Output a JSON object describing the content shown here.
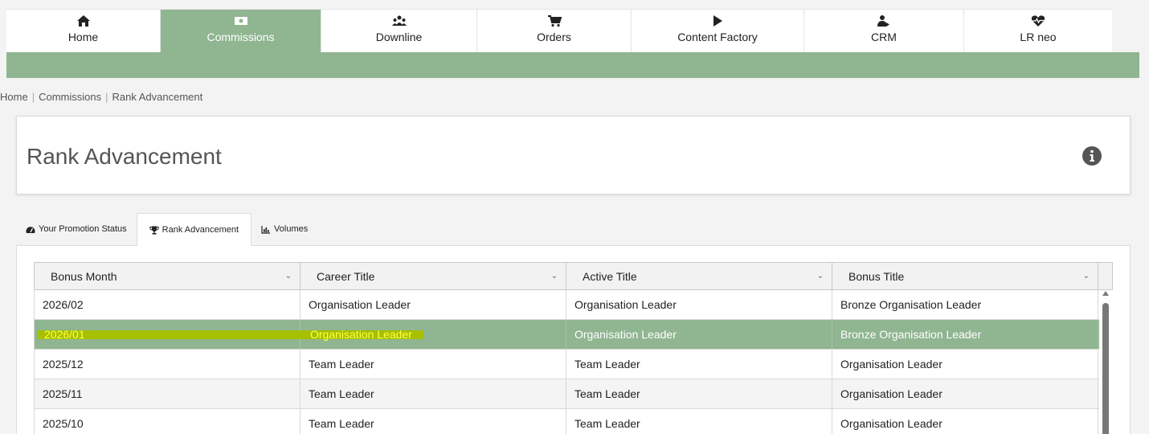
{
  "nav": {
    "items": [
      {
        "label": "Home",
        "icon": "home-icon",
        "active": false
      },
      {
        "label": "Commissions",
        "icon": "money-icon",
        "active": true
      },
      {
        "label": "Downline",
        "icon": "users-icon",
        "active": false
      },
      {
        "label": "Orders",
        "icon": "cart-icon",
        "active": false
      },
      {
        "label": "Content Factory",
        "icon": "play-icon",
        "active": false
      },
      {
        "label": "CRM",
        "icon": "user-share-icon",
        "active": false
      },
      {
        "label": "LR neo",
        "icon": "heartbeat-icon",
        "active": false
      }
    ]
  },
  "breadcrumb": [
    "Home",
    "Commissions",
    "Rank Advancement"
  ],
  "page_title": "Rank Advancement",
  "tabs": [
    {
      "label": "Your Promotion Status",
      "icon": "dashboard-icon",
      "active": false
    },
    {
      "label": "Rank Advancement",
      "icon": "trophy-icon",
      "active": true
    },
    {
      "label": "Volumes",
      "icon": "bar-chart-icon",
      "active": false
    }
  ],
  "grid": {
    "columns": [
      "Bonus Month",
      "Career Title",
      "Active Title",
      "Bonus Title"
    ],
    "rows": [
      [
        "2026/02",
        "Organisation Leader",
        "Organisation Leader",
        "Bronze Organisation Leader"
      ],
      [
        "2026/01",
        "Organisation Leader",
        "Organisation Leader",
        "Bronze Organisation Leader"
      ],
      [
        "2025/12",
        "Team Leader",
        "Team Leader",
        "Organisation Leader"
      ],
      [
        "2025/11",
        "Team Leader",
        "Team Leader",
        "Organisation Leader"
      ],
      [
        "2025/10",
        "Team Leader",
        "Team Leader",
        "Organisation Leader"
      ]
    ],
    "selected_row": 1
  },
  "colors": {
    "accent": "#90b591",
    "highlight_marker": "#a6c000",
    "highlight_text": "#ffff44"
  }
}
